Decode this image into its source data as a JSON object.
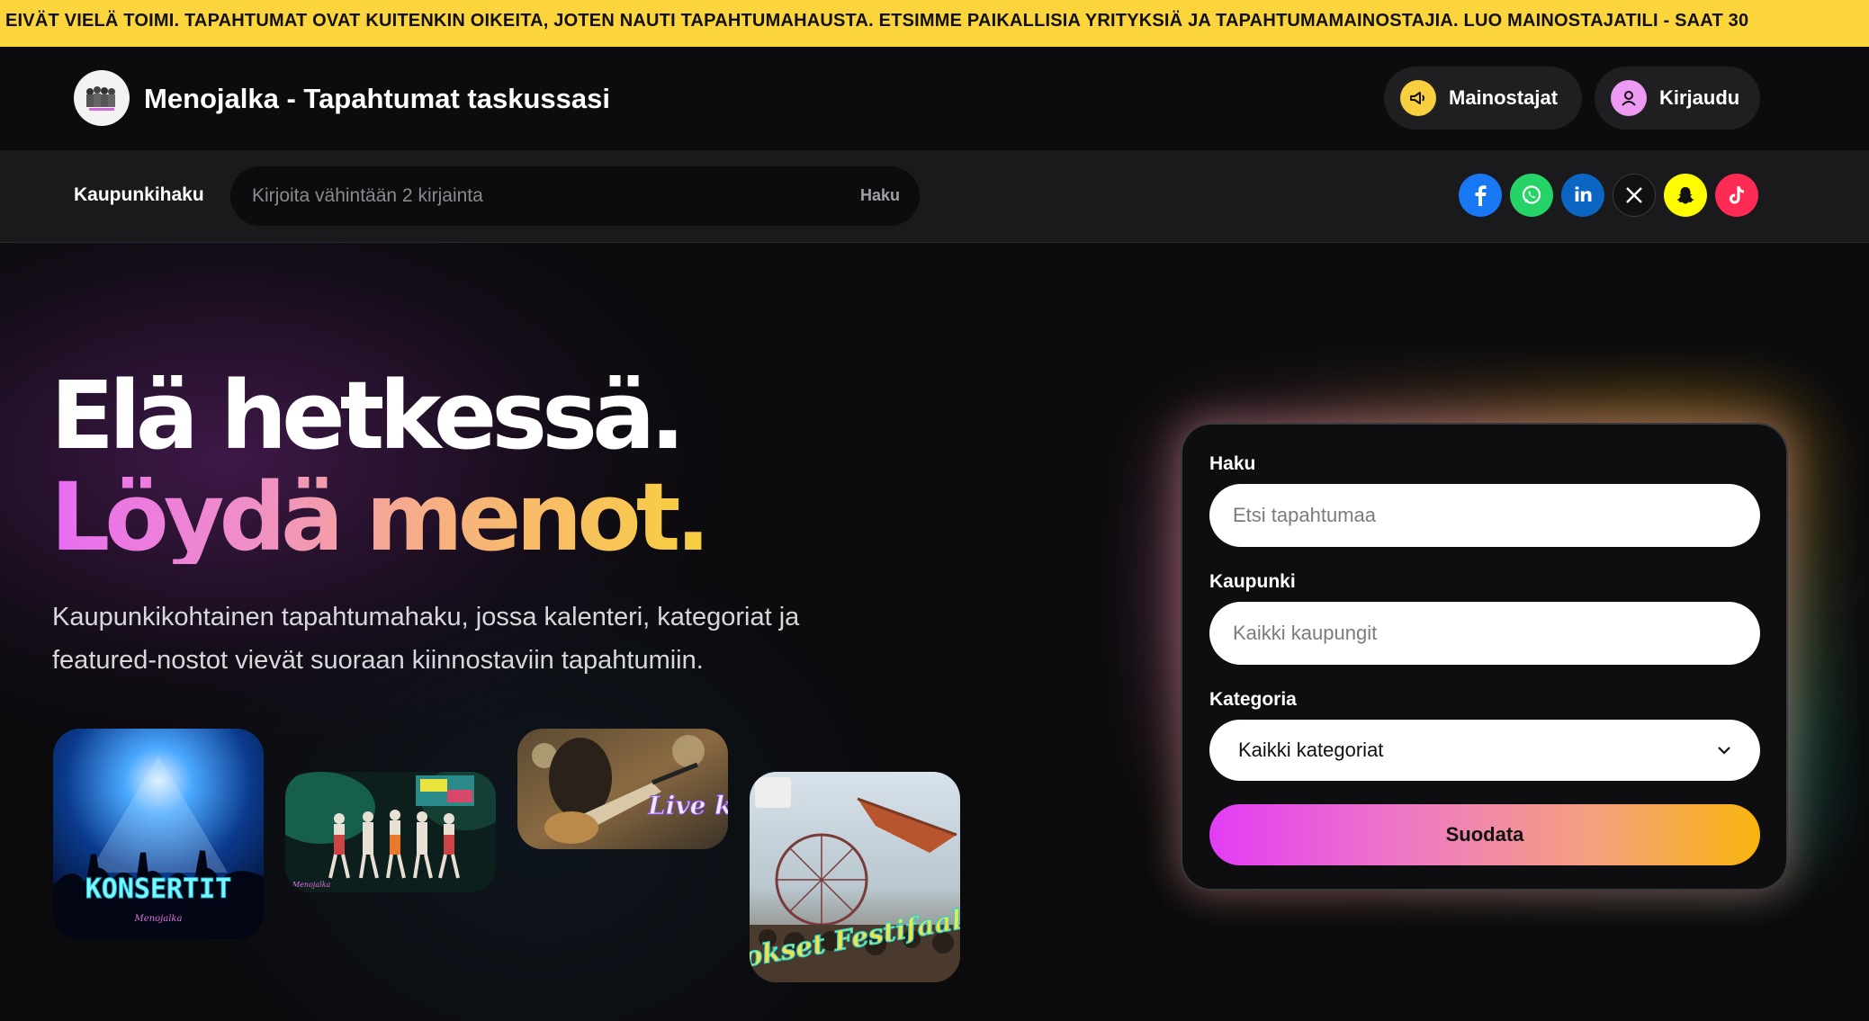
{
  "ticker": {
    "text": "EIVÄT VIELÄ TOIMI. TAPAHTUMAT OVAT KUITENKIN OIKEITA, JOTEN NAUTI TAPAHTUMAHAUSTA. ETSIMME PAIKALLISIA YRITYKSIÄ JA TAPAHTUMAMAINOSTAJIA. LUO MAINOSTAJATILI - SAAT 30"
  },
  "header": {
    "brand": "Menojalka - Tapahtumat taskussasi",
    "advertisers_label": "Mainostajat",
    "login_label": "Kirjaudu"
  },
  "citybar": {
    "label": "Kaupunkihaku",
    "placeholder": "Kirjoita vähintään 2 kirjainta",
    "button": "Haku",
    "socials": [
      {
        "name": "facebook",
        "color": "#1877f2"
      },
      {
        "name": "whatsapp",
        "color": "#25d366"
      },
      {
        "name": "linkedin",
        "color": "#0a66c2"
      },
      {
        "name": "x",
        "color": "#111111"
      },
      {
        "name": "snapchat",
        "color": "#fffc00"
      },
      {
        "name": "tiktok",
        "color": "#fe2c55"
      }
    ]
  },
  "hero": {
    "title_line1": "Elä hetkessä.",
    "title_line2": "Löydä menot.",
    "lead": "Kaupunkikohtainen tapahtumahaku, jossa kalenteri, kategoriat ja featured-nostot vievät suoraan kiinnostaviin tapahtumiin.",
    "tiles": [
      {
        "caption": "KONSERTIT",
        "signature": "Menojalka"
      },
      {
        "caption": "",
        "signature": "Menojalka"
      },
      {
        "caption": "Live keikat"
      },
      {
        "caption": "Lokset Festifaalit"
      }
    ]
  },
  "filter": {
    "search_label": "Haku",
    "search_placeholder": "Etsi tapahtumaa",
    "city_label": "Kaupunki",
    "city_placeholder": "Kaikki kaupungit",
    "category_label": "Kategoria",
    "category_value": "Kaikki kategoriat",
    "submit": "Suodata"
  },
  "colors": {
    "ticker_bg": "#fcd43b",
    "accent_pink": "#e23cf5",
    "accent_orange": "#f8b50d"
  }
}
